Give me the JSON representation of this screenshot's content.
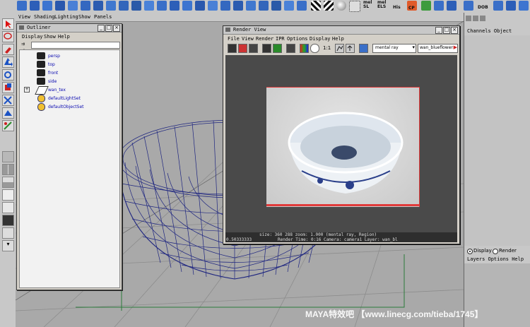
{
  "shelf": {
    "labels": [
      "mel SL",
      "mel ELS",
      "His",
      "CP",
      "DOB"
    ]
  },
  "viewport": {
    "menu": [
      "View",
      "Shading",
      "Lighting",
      "Show",
      "Panels"
    ]
  },
  "outliner": {
    "title": "Outliner",
    "menu": [
      "Display",
      "Show",
      "Help"
    ],
    "items": [
      "persp",
      "top",
      "front",
      "side",
      "wan_tex",
      "defaultLightSet",
      "defaultObjectSet"
    ]
  },
  "render_view": {
    "title": "Render View",
    "menu": [
      "File",
      "View",
      "Render",
      "IPR",
      "Options",
      "Display",
      "Help"
    ],
    "ratio_label": "1:1",
    "renderer_select": "mental ray",
    "camera_field": "wan_blueflower",
    "status_line1": "size:  360   288 zoom: 1.000        (mental ray, Region)",
    "status_line2_left": "0.50333333",
    "status_line2": "Render Time: 0:16          Camera: camera1           Layer: wan_bl"
  },
  "right_panel": {
    "header": "Channels Object",
    "radio_display": "Display",
    "radio_render": "Render",
    "layers_menu": "Layers Options Help"
  },
  "watermark": {
    "text": "MAYA特效吧 【www.linecg.com/tieba/1745】"
  },
  "colors": {
    "viewport_bg": "#a9a9a9",
    "wireframe": "#1f2680",
    "render_bg": "#4a4a4a",
    "region_border": "#e03a3a"
  }
}
